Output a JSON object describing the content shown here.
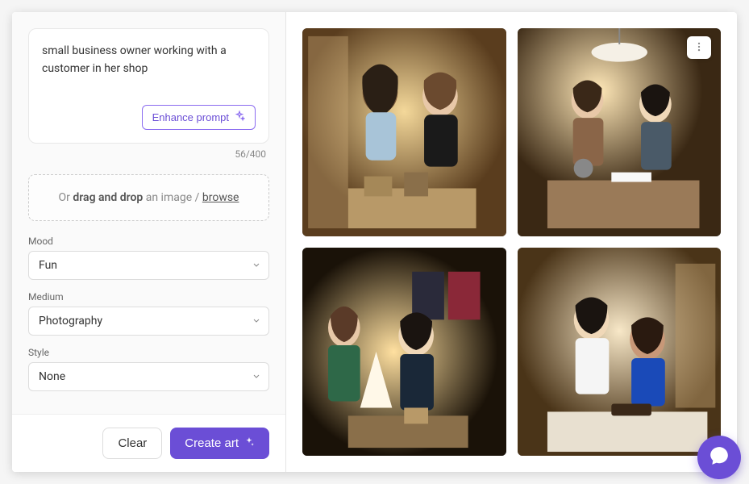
{
  "prompt": {
    "text": "small business owner working with a customer in her shop",
    "enhance_label": "Enhance prompt",
    "counter": "56/400"
  },
  "dropzone": {
    "prefix": "Or ",
    "strong": "drag and drop",
    "mid": " an image / ",
    "browse": "browse"
  },
  "fields": {
    "mood": {
      "label": "Mood",
      "value": "Fun"
    },
    "medium": {
      "label": "Medium",
      "value": "Photography"
    },
    "style": {
      "label": "Style",
      "value": "None"
    }
  },
  "actions": {
    "clear": "Clear",
    "create": "Create art"
  },
  "colors": {
    "accent": "#6b4ed6"
  }
}
